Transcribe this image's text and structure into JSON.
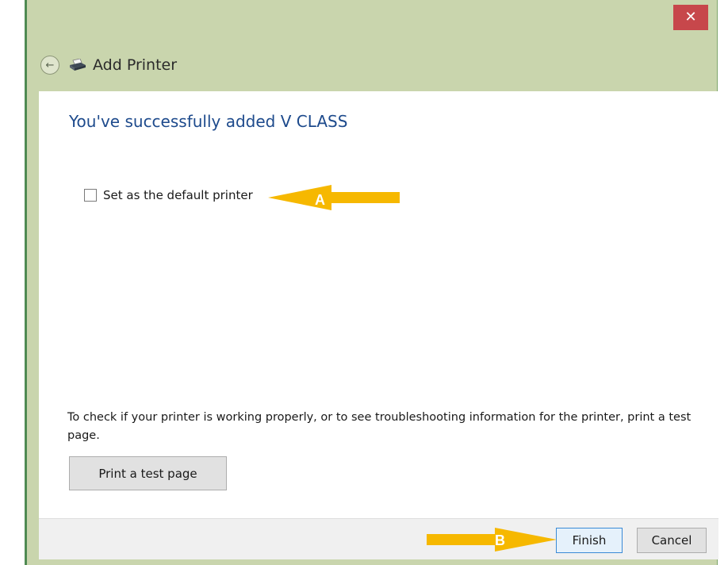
{
  "window": {
    "title": "Add Printer",
    "close_glyph": "✕",
    "back_glyph": "←"
  },
  "icons": {
    "back": "back-arrow-icon",
    "printer": "printer-icon",
    "close": "close-icon"
  },
  "main": {
    "headline": "You've successfully added V CLASS",
    "default_printer_label": "Set as the default printer",
    "default_printer_checked": false,
    "info_text": "To check if your printer is working properly, or to see troubleshooting information for the printer, print a test page.",
    "test_page_button": "Print a test page"
  },
  "footer": {
    "finish_button": "Finish",
    "cancel_button": "Cancel"
  },
  "annotations": {
    "a_label": "A",
    "b_label": "B",
    "arrow_color": "#f6b800"
  },
  "colors": {
    "title_bar": "#c9d5ad",
    "close_button": "#c7474b",
    "headline": "#1d4a8c",
    "finish_border": "#3a8ad6"
  }
}
